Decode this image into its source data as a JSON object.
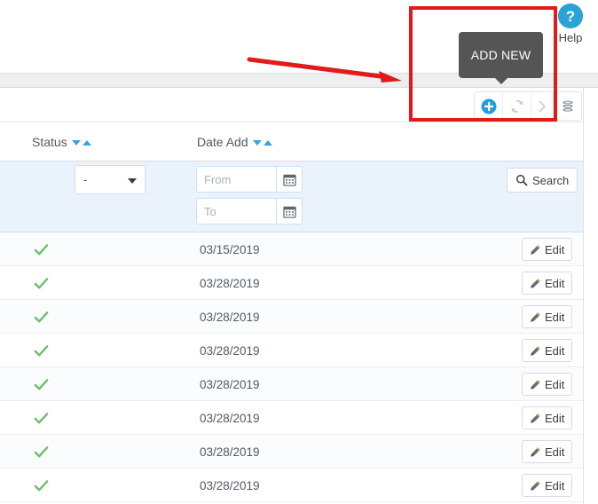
{
  "help": {
    "label": "Help",
    "icon": "question-mark-circle-icon",
    "color": "#29a3d6"
  },
  "toolbar": {
    "buttons": [
      {
        "name": "add-new",
        "icon": "plus-circle-icon",
        "color": "#1e9fe0"
      },
      {
        "name": "refresh",
        "icon": "refresh-icon",
        "color": "#c9ced3"
      },
      {
        "name": "next",
        "icon": "chevron-right-icon",
        "color": "#c9ced3"
      },
      {
        "name": "database",
        "icon": "database-stack-icon",
        "color": "#7f8c94"
      }
    ]
  },
  "tooltip": {
    "text": "ADD NEW",
    "background": "#555555"
  },
  "table": {
    "columns": [
      {
        "key": "status",
        "label": "Status",
        "sortable": true
      },
      {
        "key": "date_add",
        "label": "Date Add",
        "sortable": true
      },
      {
        "key": "actions",
        "label": "",
        "sortable": false
      }
    ],
    "filters": {
      "status_value": "-",
      "date_from_placeholder": "From",
      "date_from_value": "",
      "date_to_placeholder": "To",
      "date_to_value": "",
      "search_label": "Search",
      "search_icon": "magnifier-icon",
      "calendar_icon": "calendar-icon"
    },
    "row_action": {
      "label": "Edit",
      "icon": "pencil-icon"
    },
    "status_icon": "check-mark-icon",
    "status_color": "#6fbe6f",
    "rows": [
      {
        "status": "active",
        "date_add": "03/15/2019"
      },
      {
        "status": "active",
        "date_add": "03/28/2019"
      },
      {
        "status": "active",
        "date_add": "03/28/2019"
      },
      {
        "status": "active",
        "date_add": "03/28/2019"
      },
      {
        "status": "active",
        "date_add": "03/28/2019"
      },
      {
        "status": "active",
        "date_add": "03/28/2019"
      },
      {
        "status": "active",
        "date_add": "03/28/2019"
      },
      {
        "status": "active",
        "date_add": "03/28/2019"
      }
    ]
  },
  "annotations": {
    "highlight_rect_color": "#e11b1b",
    "arrow_color": "#e11b1b"
  }
}
